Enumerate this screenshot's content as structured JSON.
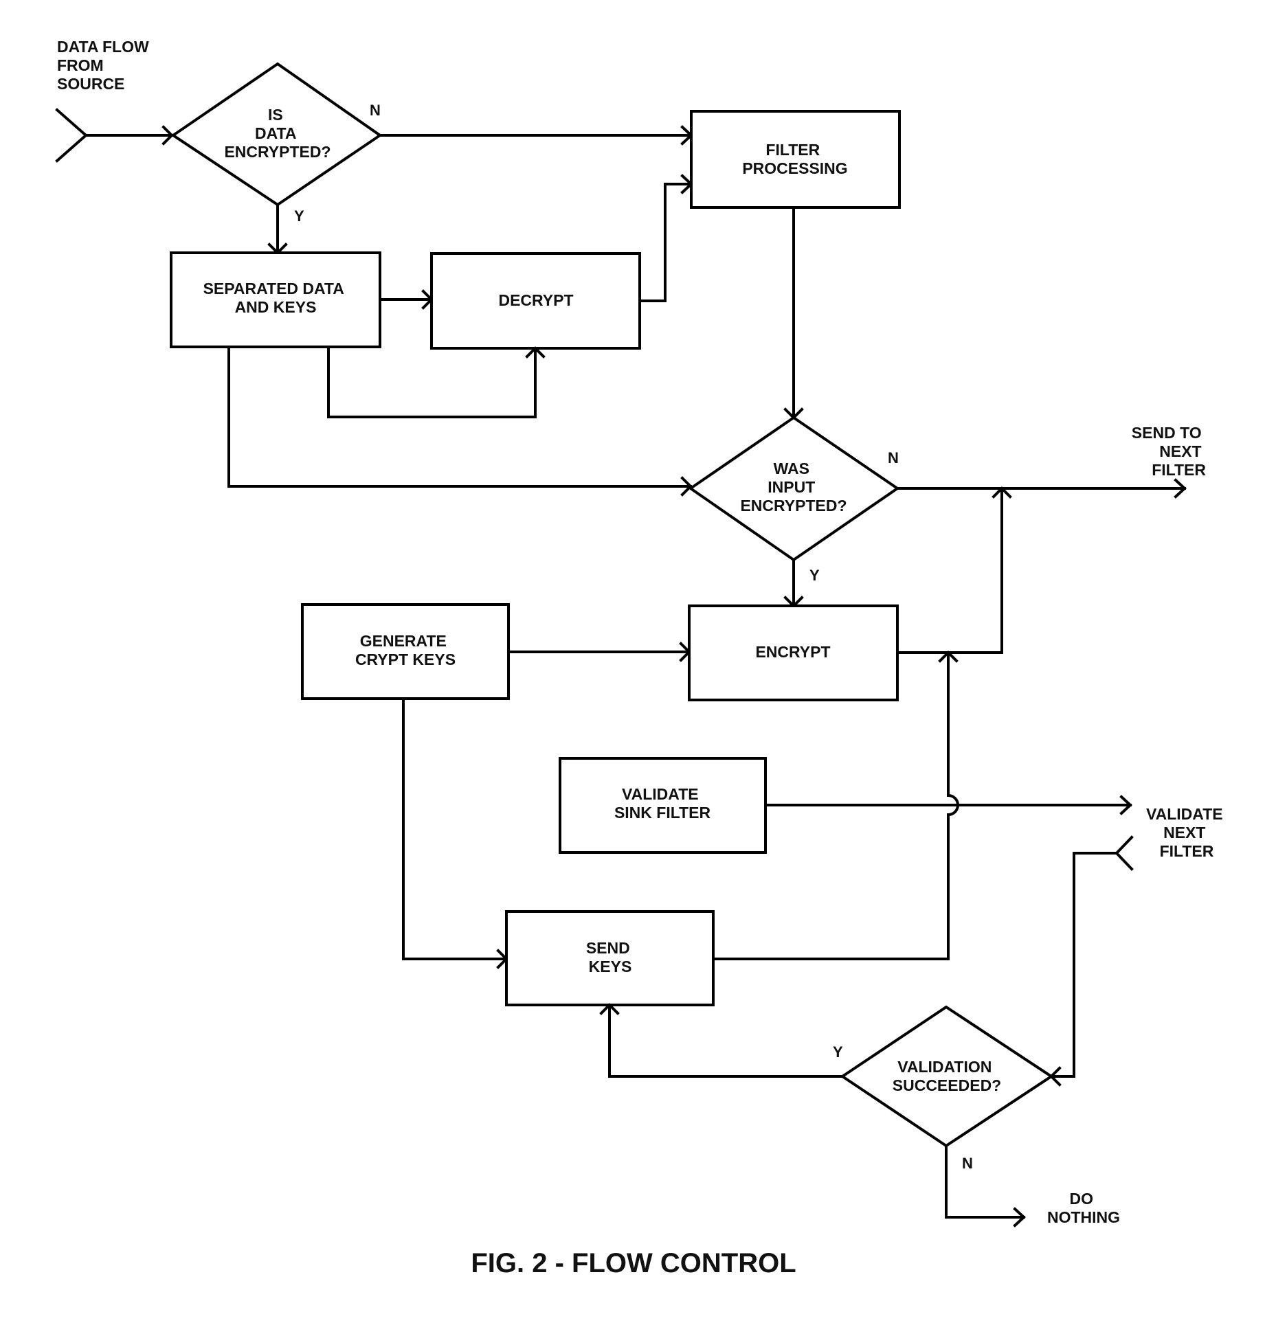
{
  "figure": {
    "title": "FIG. 2 - FLOW CONTROL"
  },
  "terminals": {
    "source": [
      "DATA FLOW",
      "FROM",
      "SOURCE"
    ],
    "send_next": [
      "SEND TO",
      "NEXT",
      "FILTER"
    ],
    "validate_next": [
      "VALIDATE",
      "NEXT",
      "FILTER"
    ],
    "do_nothing": [
      "DO",
      "NOTHING"
    ]
  },
  "decisions": {
    "is_encrypted": [
      "IS",
      "DATA",
      "ENCRYPTED?"
    ],
    "was_input_encrypted": [
      "WAS",
      "INPUT",
      "ENCRYPTED?"
    ],
    "validation_succeeded": [
      "VALIDATION",
      "SUCCEEDED?"
    ]
  },
  "processes": {
    "separated": [
      "SEPARATED DATA",
      "AND KEYS"
    ],
    "decrypt": [
      "DECRYPT"
    ],
    "filter": [
      "FILTER",
      "PROCESSING"
    ],
    "generate": [
      "GENERATE",
      "CRYPT KEYS"
    ],
    "encrypt": [
      "ENCRYPT"
    ],
    "validate_sink": [
      "VALIDATE",
      "SINK FILTER"
    ],
    "send_keys": [
      "SEND",
      "KEYS"
    ]
  },
  "branch_labels": {
    "yes": "Y",
    "no": "N"
  }
}
